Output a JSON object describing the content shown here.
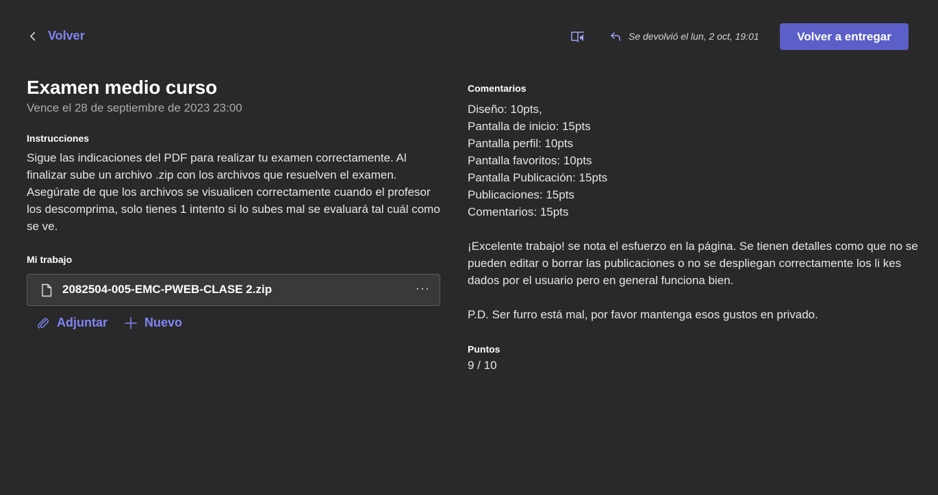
{
  "header": {
    "back_label": "Volver",
    "returned_text": "Se devolvió el lun, 2 oct, 19:01",
    "resubmit_label": "Volver a entregar"
  },
  "assignment": {
    "title": "Examen medio curso",
    "due": "Vence el 28 de septiembre de 2023 23:00",
    "instructions_label": "Instrucciones",
    "instructions": "Sigue las indicaciones del PDF para realizar tu examen correctamente. Al finalizar sube un archivo .zip con los archivos que resuelven el examen. Asegúrate de que los archivos se visualicen correctamente cuando el profesor los descomprima, solo tienes 1 intento si lo subes mal se evaluará tal cuál como se ve.",
    "my_work_label": "Mi trabajo",
    "file_name": "2082504-005-EMC-PWEB-CLASE 2.zip",
    "attach_label": "Adjuntar",
    "new_label": "Nuevo"
  },
  "feedback": {
    "comments_label": "Comentarios",
    "comments": "Diseño: 10pts,\nPantalla de inicio: 15pts\nPantalla perfil: 10pts\nPantalla favoritos: 10pts\nPantalla Publicación: 15pts\nPublicaciones: 15pts\nComentarios: 15pts\n\n¡Excelente trabajo! se nota el esfuerzo en la página. Se tienen detalles como que no se pueden editar o borrar las publicaciones o no se despliegan correctamente los li kes dados por el usuario pero en general funciona bien.\n\nP.D. Ser furro está mal, por favor mantenga esos gustos en privado.",
    "points_label": "Puntos",
    "points": "9 / 10"
  },
  "icons": {
    "back": "chevron-left-icon",
    "reader": "immersive-reader-icon",
    "returned": "return-arrow-icon",
    "file": "file-icon",
    "more": "more-options-icon",
    "attach": "paperclip-icon",
    "new": "plus-icon"
  },
  "colors": {
    "background": "#292929",
    "accent": "#7f85f5",
    "button": "#5b5fc7",
    "card": "#3a3937"
  }
}
